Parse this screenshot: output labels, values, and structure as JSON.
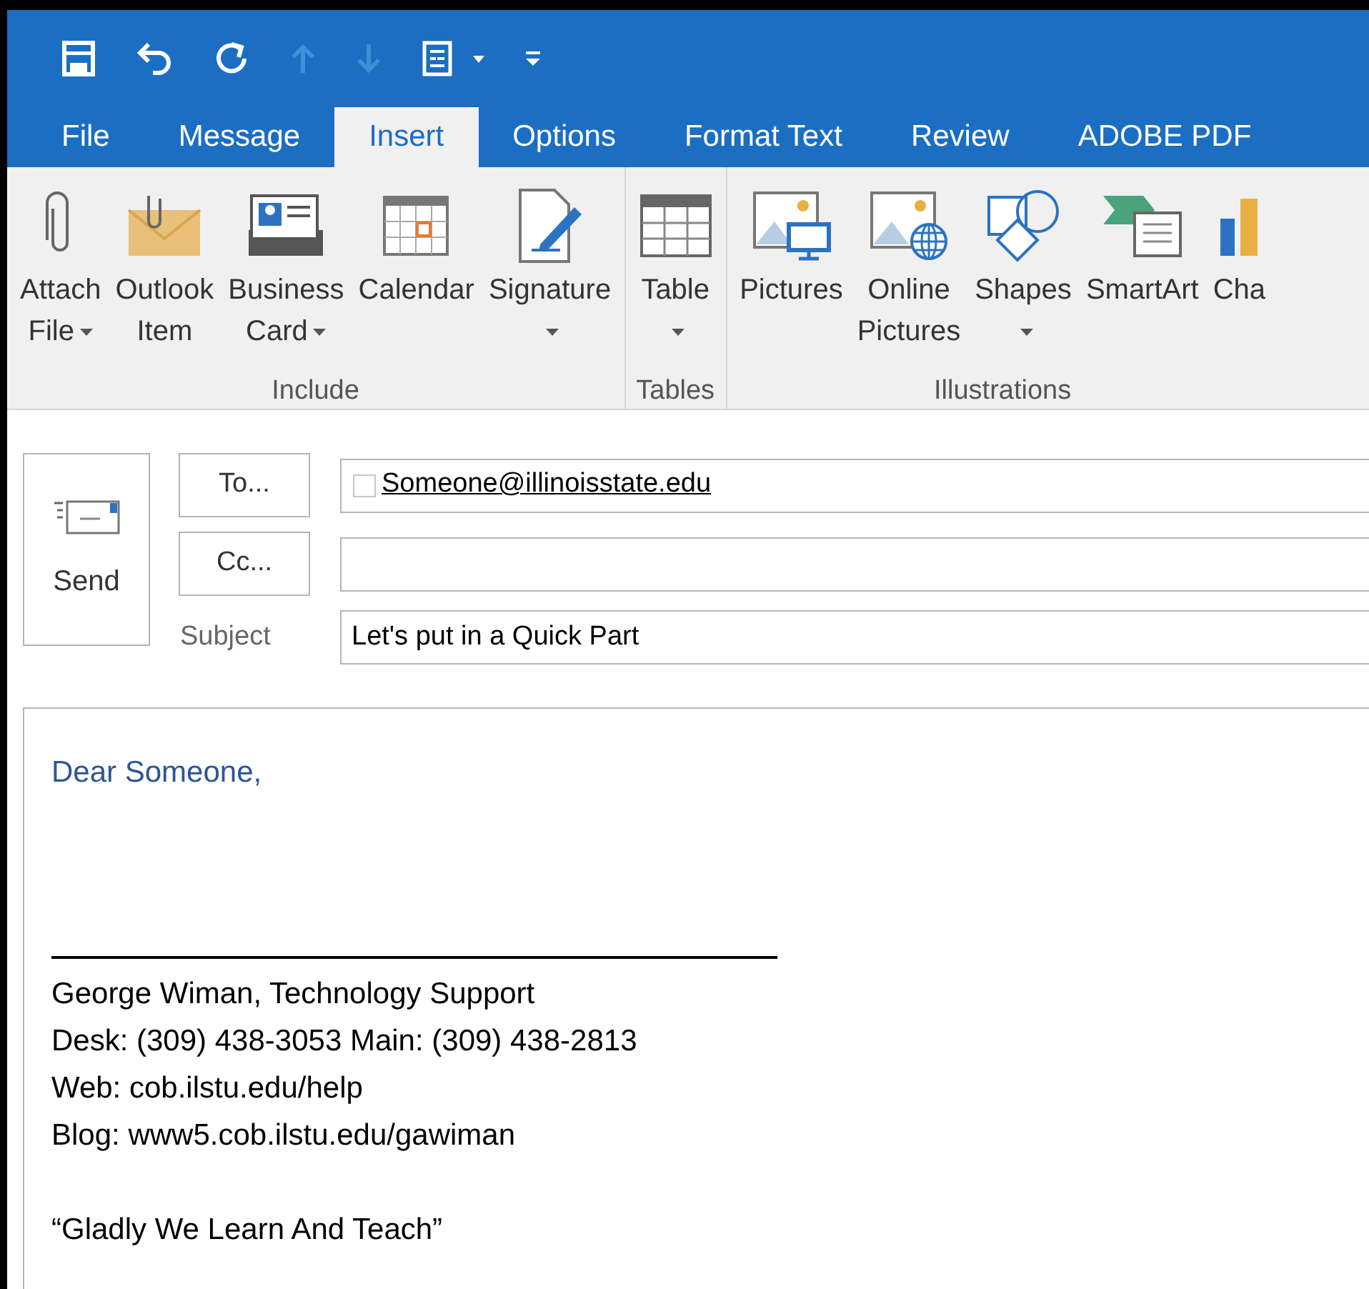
{
  "quick_access": [
    {
      "kind": "save",
      "disabled": false
    },
    {
      "kind": "undo",
      "disabled": false
    },
    {
      "kind": "redo",
      "disabled": false
    },
    {
      "kind": "up",
      "disabled": true
    },
    {
      "kind": "down",
      "disabled": true
    },
    {
      "kind": "form",
      "disabled": false
    },
    {
      "kind": "customize",
      "disabled": false
    }
  ],
  "tabs": [
    {
      "label": "File",
      "selected": false
    },
    {
      "label": "Message",
      "selected": false
    },
    {
      "label": "Insert",
      "selected": true
    },
    {
      "label": "Options",
      "selected": false
    },
    {
      "label": "Format Text",
      "selected": false
    },
    {
      "label": "Review",
      "selected": false
    },
    {
      "label": "ADOBE PDF",
      "selected": false
    }
  ],
  "ribbon_groups": [
    {
      "label": "Include",
      "buttons": [
        {
          "kind": "paperclip",
          "lines": [
            "Attach",
            "File"
          ],
          "dropdown": true
        },
        {
          "kind": "envelope",
          "lines": [
            "Outlook",
            "Item"
          ],
          "dropdown": false
        },
        {
          "kind": "card",
          "lines": [
            "Business",
            "Card"
          ],
          "dropdown": true
        },
        {
          "kind": "calendar",
          "lines": [
            "Calendar"
          ],
          "dropdown": false
        },
        {
          "kind": "signature",
          "lines": [
            "Signature"
          ],
          "dropdown": true
        }
      ]
    },
    {
      "label": "Tables",
      "buttons": [
        {
          "kind": "table",
          "lines": [
            "Table"
          ],
          "dropdown": true
        }
      ]
    },
    {
      "label": "Illustrations",
      "buttons": [
        {
          "kind": "pictures",
          "lines": [
            "Pictures"
          ],
          "dropdown": false
        },
        {
          "kind": "online",
          "lines": [
            "Online",
            "Pictures"
          ],
          "dropdown": false
        },
        {
          "kind": "shapes",
          "lines": [
            "Shapes"
          ],
          "dropdown": true
        },
        {
          "kind": "smartart",
          "lines": [
            "SmartArt"
          ],
          "dropdown": false
        },
        {
          "kind": "chart",
          "lines": [
            "Cha"
          ],
          "dropdown": false
        }
      ]
    }
  ],
  "send": {
    "label": "Send"
  },
  "to": {
    "label": "To...",
    "value": "Someone@illinoisstate.edu"
  },
  "cc": {
    "label": "Cc..."
  },
  "subject": {
    "label": "Subject",
    "value": "Let's put in a Quick Part"
  },
  "body": {
    "greeting": "Dear Someone,",
    "signature": [
      "George Wiman, Technology Support",
      "Desk: (309) 438-3053 Main: (309) 438-2813",
      "Web: cob.ilstu.edu/help",
      "Blog: www5.cob.ilstu.edu/gawiman"
    ],
    "motto": "“Gladly We Learn And Teach”"
  }
}
